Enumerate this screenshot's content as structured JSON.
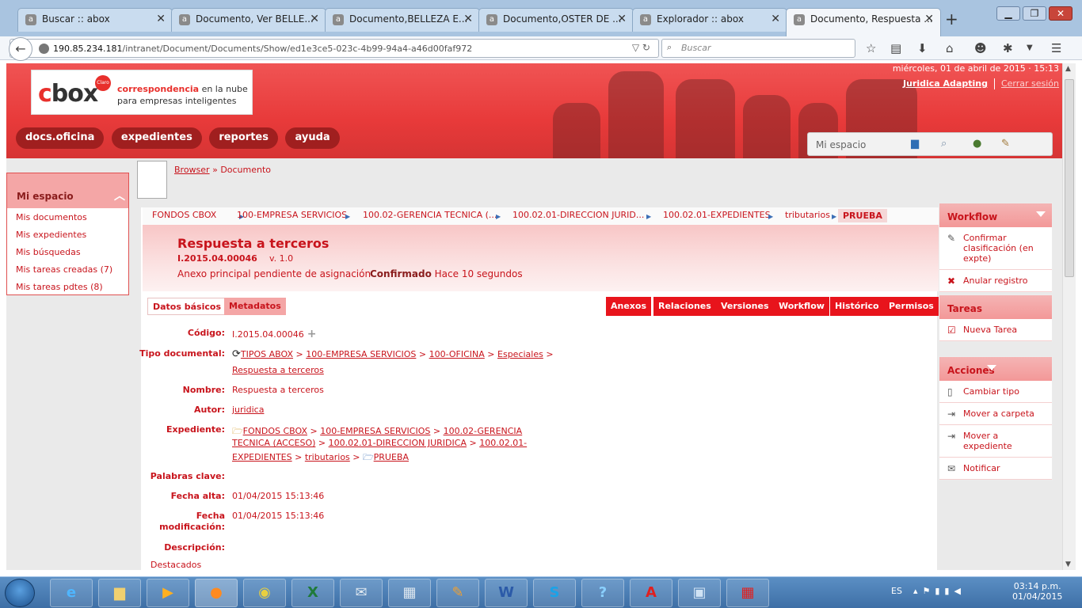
{
  "browser": {
    "tabs": [
      {
        "title": "Buscar :: abox"
      },
      {
        "title": "Documento, Ver BELLE..."
      },
      {
        "title": "Documento,BELLEZA E..."
      },
      {
        "title": "Documento,OSTER DE ..."
      },
      {
        "title": "Explorador :: abox"
      },
      {
        "title": "Documento, Respuesta ..."
      }
    ],
    "url_host": "190.85.234.181",
    "url_path": "/intranet/Document/Documents/Show/ed1e3ce5-023c-4b99-94a4-a46d00faf972",
    "search_placeholder": "Buscar"
  },
  "header": {
    "logo_text_c": "c",
    "logo_text_rest": "box",
    "logo_badge": "Claro",
    "tagline_bold": "correspondencia",
    "tagline_1": " en la nube",
    "tagline_2": "para empresas inteligentes",
    "nav": [
      "docs.oficina",
      "expedientes",
      "reportes",
      "ayuda"
    ],
    "datetime": "miércoles, 01 de abril de 2015 · 15:13",
    "user_link": "Juridica Adapting",
    "logout_link": "Cerrar sesión",
    "mi_espacio": "Mi espacio"
  },
  "left": {
    "title": "Mi espacio",
    "links": [
      "Mis documentos",
      "Mis expedientes",
      "Mis búsquedas",
      "Mis tareas creadas (7)",
      "Mis tareas pdtes (8)"
    ]
  },
  "crumb": {
    "browser": "Browser",
    "sep": " » ",
    "current": "Documento"
  },
  "path": [
    "FONDOS CBOX",
    "100-EMPRESA SERVICIOS",
    "100.02-GERENCIA TECNICA (...",
    "100.02.01-DIRECCION JURID...",
    "100.02.01-EXPEDIENTES",
    "tributarios"
  ],
  "path_last": "PRUEBA",
  "doc": {
    "title": "Respuesta a terceros",
    "code": "I.2015.04.00046",
    "version": "v. 1.0",
    "annex": "Anexo principal pendiente de asignación",
    "status_bold": "Confirmado",
    "status_rest": " Hace 10 segundos"
  },
  "tabs_left": [
    "Datos básicos",
    "Metadatos"
  ],
  "tabs_right": [
    "Anexos",
    "Relaciones",
    "Versiones",
    "Workflow",
    "Histórico",
    "Permisos"
  ],
  "fields": {
    "codigo_lbl": "Código:",
    "codigo_val": "I.2015.04.00046",
    "tipo_lbl": "Tipo documental:",
    "tipo_parts": [
      "TIPOS ABOX",
      "100-EMPRESA SERVICIOS",
      "100-OFICINA",
      "Especiales"
    ],
    "tipo_last": "Respuesta a terceros",
    "nombre_lbl": "Nombre:",
    "nombre_val": "Respuesta a terceros",
    "autor_lbl": "Autor:",
    "autor_val": "juridica",
    "exp_lbl": "Expediente:",
    "exp_line1a": "FONDOS CBOX",
    "exp_line1b": "100-EMPRESA SERVICIOS",
    "exp_line1c": "100.02-GERENCIA",
    "exp_line2a": "TECNICA (ACCESO)",
    "exp_line2b": "100.02.01-DIRECCION JURIDICA",
    "exp_line2c": "100.02.01-",
    "exp_line3a": "EXPEDIENTES",
    "exp_line3b": "tributarios",
    "exp_line3c": "PRUEBA",
    "palabras_lbl": "Palabras clave:",
    "alta_lbl": "Fecha alta:",
    "alta_val": "01/04/2015 15:13:46",
    "mod_lbl1": "Fecha",
    "mod_lbl2": "modificación:",
    "mod_val": "01/04/2015 15:13:46",
    "desc_lbl": "Descripción:",
    "destacados": "Destacados"
  },
  "right": {
    "workflow_title": "Workflow",
    "workflow_items": [
      "Confirmar clasificación (en expte)",
      "Anular registro"
    ],
    "tareas_title": "Tareas",
    "tareas_items": [
      "Nueva Tarea"
    ],
    "acciones_title": "Acciones",
    "acciones_items": [
      "Cambiar tipo",
      "Mover a carpeta",
      "Mover a expediente",
      "Notificar"
    ]
  },
  "taskbar": {
    "lang": "ES",
    "time": "03:14 p.m.",
    "date": "01/04/2015"
  }
}
